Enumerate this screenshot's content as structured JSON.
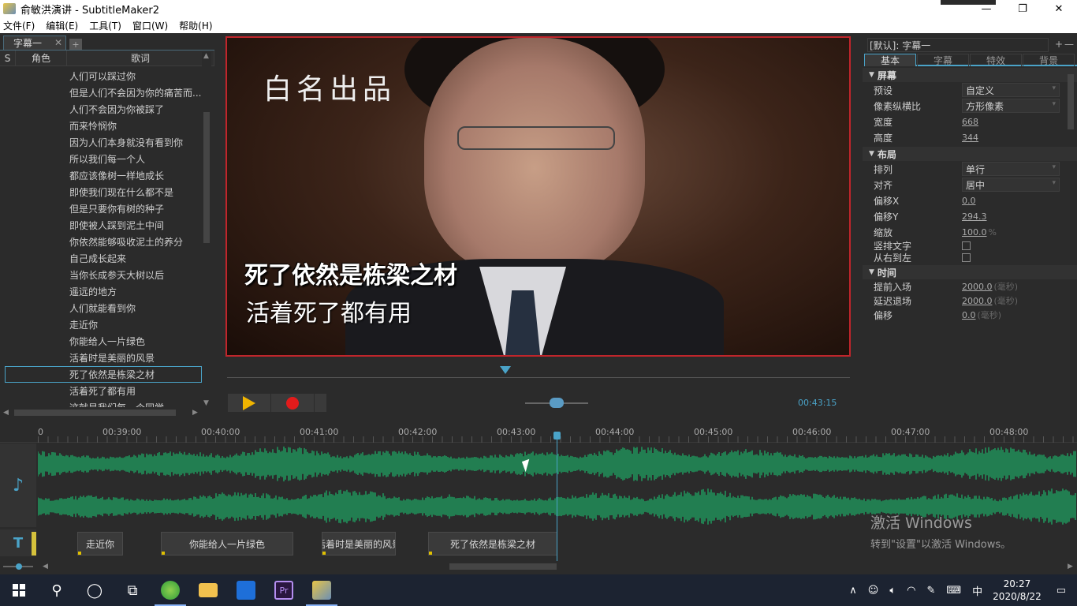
{
  "window": {
    "title": "俞敏洪演讲 - SubtitleMaker2",
    "controls": {
      "minimize": "—",
      "maximize": "❐",
      "close": "✕"
    }
  },
  "menu": [
    "文件(F)",
    "编辑(E)",
    "工具(T)",
    "窗口(W)",
    "帮助(H)"
  ],
  "left_panel": {
    "tab_label": "字幕一",
    "tab_close": "✕",
    "tab_add": "+",
    "columns": {
      "s": "S",
      "role": "角色",
      "lyric": "歌词"
    },
    "lyrics": [
      "人们可以踩过你",
      "但是人们不会因为你的痛苦而...",
      "人们不会因为你被踩了",
      "而来怜悯你",
      "因为人们本身就没有看到你",
      "所以我们每一个人",
      "都应该像树一样地成长",
      "即使我们现在什么都不是",
      "但是只要你有树的种子",
      "即使被人踩到泥土中间",
      "你依然能够吸收泥土的养分",
      "自己成长起来",
      "当你长成参天大树以后",
      "遥远的地方",
      "人们就能看到你",
      "走近你",
      "你能给人一片绿色",
      "活着时是美丽的风景",
      "死了依然是栋梁之材",
      "活着死了都有用",
      "这就是我们每一个同学"
    ],
    "selected_index": 18
  },
  "video": {
    "watermark": "白名出品",
    "subtitle_line1": "死了依然是栋梁之材",
    "subtitle_line2": "活着死了都有用"
  },
  "playback": {
    "time": "00:43:15"
  },
  "right_panel": {
    "preset_dropdown": "[默认]: 字幕一",
    "plus": "+",
    "minus": "—",
    "tabs": [
      "基本",
      "字幕",
      "特效",
      "背景"
    ],
    "active_tab": "基本",
    "sections": {
      "screen": {
        "title": "屏幕",
        "preset_label": "预设",
        "preset_value": "自定义",
        "aspect_label": "像素纵横比",
        "aspect_value": "方形像素",
        "width_label": "宽度",
        "width_value": "668",
        "height_label": "高度",
        "height_value": "344"
      },
      "layout": {
        "title": "布局",
        "arrange_label": "排列",
        "arrange_value": "单行",
        "align_label": "对齐",
        "align_value": "居中",
        "offset_x_label": "偏移X",
        "offset_x_value": "0.0",
        "offset_y_label": "偏移Y",
        "offset_y_value": "294.3",
        "scale_label": "缩放",
        "scale_value": "100.0",
        "scale_unit": "%",
        "vertical_label": "竖排文字",
        "rtl_label": "从右到左"
      },
      "time": {
        "title": "时间",
        "lead_in_label": "提前入场",
        "lead_in_value": "2000.0",
        "lead_in_unit": "(毫秒)",
        "delay_out_label": "延迟退场",
        "delay_out_value": "2000.0",
        "delay_out_unit": "(毫秒)",
        "offset_label": "偏移",
        "offset_value": "0.0",
        "offset_unit": "(毫秒)"
      }
    }
  },
  "timeline": {
    "ruler_labels": [
      "0",
      "00:39:00",
      "00:40:00",
      "00:41:00",
      "00:42:00",
      "00:43:00",
      "00:44:00",
      "00:45:00",
      "00:46:00",
      "00:47:00",
      "00:48:00"
    ],
    "audio_icon": "♪",
    "subtitle_icon": "T",
    "subtitle_blocks": [
      "走近你",
      "你能给人一片绿色",
      "活着时是美丽的风景",
      "死了依然是栋梁之材"
    ],
    "wave_color": "#1f9a5e",
    "playhead_color": "#4aa3c8"
  },
  "activation": {
    "line1": "激活 Windows",
    "line2": "转到\"设置\"以激活 Windows。"
  },
  "taskbar": {
    "ime": "中",
    "time": "20:27",
    "date": "2020/8/22",
    "tray_up": "∧",
    "notification_icon": "▭"
  }
}
